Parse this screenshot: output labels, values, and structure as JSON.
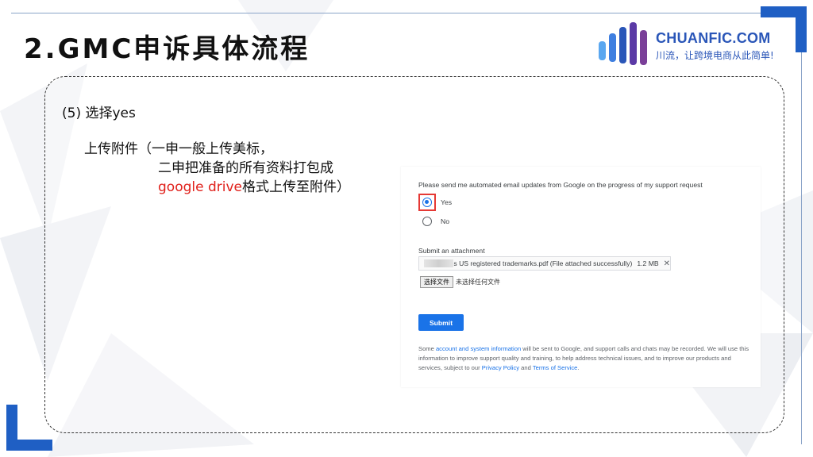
{
  "slide": {
    "title": "2.GMC申诉具体流程",
    "step_title": "(5) 选择yes",
    "desc": {
      "line1": "上传附件（一申一般上传美标，",
      "line2": "二申把准备的所有资料打包成",
      "line3_red": "google drive",
      "line3_rest": "格式上传至附件）"
    }
  },
  "logo": {
    "name": "CHUANFIC.COM",
    "slogan": "川流，让跨境电商从此简单!"
  },
  "colors": {
    "accent_blue": "#1f5fc4",
    "highlight_red": "#e53935",
    "google_blue": "#1a73e8",
    "text_red": "#e0201a"
  },
  "form": {
    "question": "Please send me automated email updates from Google on the progress of my support request",
    "options": [
      {
        "label": "Yes",
        "selected": true
      },
      {
        "label": "No",
        "selected": false
      }
    ],
    "attachment_label": "Submit an attachment",
    "file": {
      "name": "s US registered trademarks.pdf (File attached successfully)",
      "size": "1.2 MB",
      "remove_icon": "close-icon"
    },
    "choose_button": "选择文件",
    "choose_status": "未选择任何文件",
    "submit_label": "Submit",
    "footer": {
      "t1": "Some ",
      "link1": "account and system information",
      "t2": " will be sent to Google, and support calls and chats may be recorded. We will use this information to improve support quality and training, to help address technical issues, and to improve our products and services, subject to our ",
      "link2": "Privacy Policy",
      "t3": " and ",
      "link3": "Terms of Service",
      "t4": "."
    }
  }
}
